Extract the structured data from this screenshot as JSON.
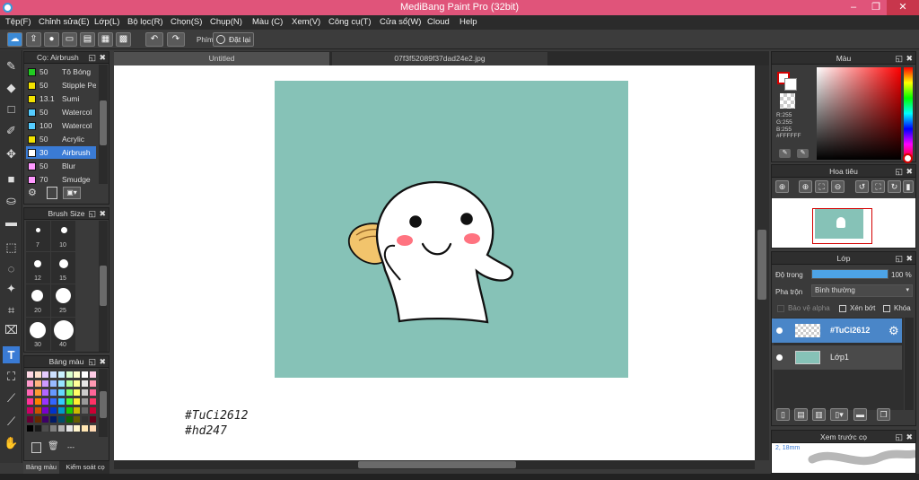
{
  "window": {
    "title": "MediBang Paint Pro (32bit)",
    "minimize": "–",
    "maximize": "❐",
    "close": "✕"
  },
  "menu": [
    "Tệp(F)",
    "Chỉnh sửa(E)",
    "Lớp(L)",
    "Bộ lọc(R)",
    "Chọn(S)",
    "Chụp(N)",
    "Màu (C)",
    "Xem(V)",
    "Công cụ(T)",
    "Cửa sổ(W)",
    "Cloud",
    "Help"
  ],
  "toolbar": {
    "phim_label": "Phím",
    "reset_label": "Đặt lại"
  },
  "brush_panel": {
    "title": "Cọ: Airbrush",
    "items": [
      {
        "size": "50",
        "name": "Tô Bóng",
        "color": "#22cc22"
      },
      {
        "size": "50",
        "name": "Stipple Pe",
        "color": "#f2e200"
      },
      {
        "size": "13.1",
        "name": "Sumi",
        "color": "#f2e200"
      },
      {
        "size": "50",
        "name": "Watercol",
        "color": "#55ccff"
      },
      {
        "size": "100",
        "name": "Watercol",
        "color": "#55ccff"
      },
      {
        "size": "50",
        "name": "Acrylic",
        "color": "#f2e200"
      },
      {
        "size": "30",
        "name": "Airbrush",
        "color": "#ffffff",
        "selected": true
      },
      {
        "size": "50",
        "name": "Blur",
        "color": "#ff99ff"
      },
      {
        "size": "70",
        "name": "Smudge",
        "color": "#ff99ff"
      }
    ]
  },
  "brush_size_panel": {
    "title": "Brush Size",
    "sizes": [
      "7",
      "10",
      "12",
      "15",
      "20",
      "25",
      "30",
      "40"
    ]
  },
  "palette_panel": {
    "title": "Bảng màu",
    "name_value": "---",
    "tabs": [
      "Bảng màu",
      "Kiểm soát cọ"
    ],
    "colors": [
      [
        "#ffd9e6",
        "#ffe0cc",
        "#e6ccff",
        "#cce0ff",
        "#ccf2ff",
        "#d9ffcc",
        "#ffffcc",
        "#ffffff",
        "#ffcce6",
        "#ffcccc"
      ],
      [
        "#ff99cc",
        "#ffb380",
        "#cc99ff",
        "#99bbff",
        "#99e6ff",
        "#b3ff99",
        "#ffff99",
        "#e6e6e6",
        "#ff99b3",
        "#ff9999"
      ],
      [
        "#ff66b3",
        "#ff9933",
        "#b366ff",
        "#6699ff",
        "#66d9ff",
        "#80ff66",
        "#ffff66",
        "#cccccc",
        "#ff6699",
        "#ff6666"
      ],
      [
        "#ff3399",
        "#ff8000",
        "#9933ff",
        "#3366ff",
        "#33ccff",
        "#4dff33",
        "#ffee33",
        "#999999",
        "#ff3366",
        "#ff3333"
      ],
      [
        "#cc0066",
        "#cc5200",
        "#7a00cc",
        "#0033cc",
        "#0099cc",
        "#1acc00",
        "#ccbb00",
        "#666666",
        "#cc0033",
        "#cc0000"
      ],
      [
        "#660033",
        "#662900",
        "#3d0066",
        "#001a66",
        "#004d66",
        "#0d6600",
        "#665e00",
        "#333333",
        "#660019",
        "#660000"
      ],
      [
        "#000000",
        "#1a1a1a",
        "#4d4d4d",
        "#808080",
        "#b3b3b3",
        "#e6e6e6",
        "#fff5cc",
        "#ffe6b3",
        "#ffd9b3",
        "#e6ccb3"
      ]
    ]
  },
  "document_tabs": [
    "Untitled",
    "07f3f52089f37dad24e2.jpg"
  ],
  "canvas": {
    "background": "#86c2b7",
    "text_line1": "#TuCi2612",
    "text_line2": "#hd247"
  },
  "color_panel": {
    "title": "Màu",
    "r": "R:255",
    "g": "G:255",
    "b": "B:255",
    "hex": "#FFFFFF",
    "accent": "#d40000"
  },
  "navigator_panel": {
    "title": "Hoa tiêu"
  },
  "layer_panel": {
    "title": "Lớp",
    "opacity_label": "Độ trong",
    "opacity_value": "100 %",
    "opacity": 1.0,
    "blend_label": "Pha trộn",
    "blend_value": "Bình thường",
    "protect_alpha": "Bảo vệ alpha",
    "clipping": "Xén bớt",
    "lock": "Khóa",
    "layers": [
      {
        "name": "#TuCi2612",
        "selected": true
      },
      {
        "name": "Lớp1",
        "selected": false
      }
    ]
  },
  "brush_preview_panel": {
    "title": "Xem trước cọ",
    "size_label": "2, 18mm"
  }
}
